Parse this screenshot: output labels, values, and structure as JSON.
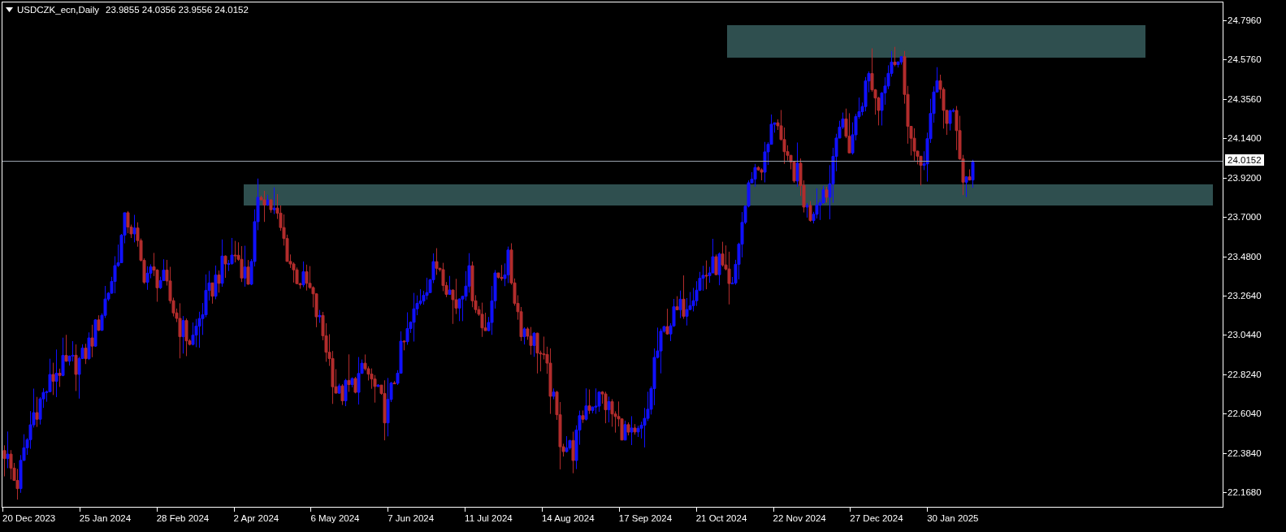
{
  "chart_header": {
    "symbol_timeframe": "USDCZK_ecn,Daily",
    "ohlc": "23.9855 24.0356 23.9556 24.0152"
  },
  "price_axis": {
    "labels": [
      "24.7960",
      "24.5760",
      "24.3560",
      "24.1400",
      "23.9200",
      "23.7000",
      "23.4800",
      "23.2640",
      "23.0440",
      "22.8240",
      "22.6040",
      "22.3840",
      "22.1680"
    ],
    "current_price": "24.0152"
  },
  "time_axis": {
    "labels": [
      "20 Dec 2023",
      "25 Jan 2024",
      "28 Feb 2024",
      "2 Apr 2024",
      "6 May 2024",
      "7 Jun 2024",
      "11 Jul 2024",
      "14 Aug 2024",
      "17 Sep 2024",
      "21 Oct 2024",
      "22 Nov 2024",
      "27 Dec 2024",
      "30 Jan 2025"
    ]
  }
}
